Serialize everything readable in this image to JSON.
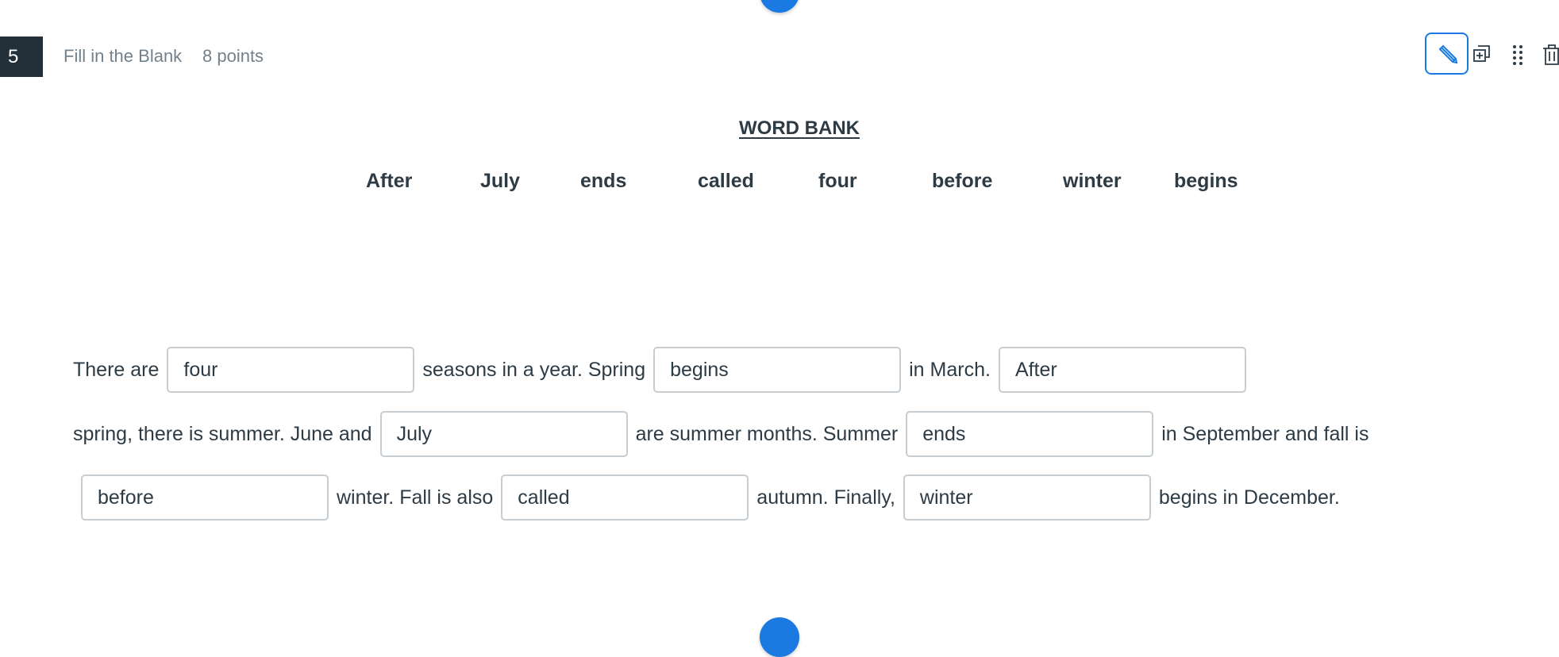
{
  "question": {
    "number": "5",
    "type": "Fill in the Blank",
    "points": "8 points"
  },
  "toolbar": {
    "edit": "pencil-icon",
    "duplicate": "duplicate-icon",
    "drag": "drag-handle-icon",
    "delete": "trash-icon"
  },
  "word_bank": {
    "title": "WORD BANK",
    "words": [
      "After",
      "July",
      "ends",
      "called",
      "four",
      "before",
      "winter",
      "begins"
    ]
  },
  "passage": {
    "line1": {
      "t1": "There are",
      "b1": "four",
      "t2": "seasons in a year. Spring",
      "b2": "begins",
      "t3": "in March.",
      "b3": "After"
    },
    "line2": {
      "t1": "spring, there is summer. June and",
      "b1": "July",
      "t2": "are summer months. Summer",
      "b2": "ends",
      "t3": "in September and fall is"
    },
    "line3": {
      "b1": "before",
      "t1": "winter. Fall is also",
      "b2": "called",
      "t2": "autumn. Finally,",
      "b3": "winter",
      "t3": "begins in December."
    }
  },
  "colors": {
    "accent": "#1a7ae2",
    "number_badge": "#243039",
    "text": "#2d3b45",
    "muted": "#73818c",
    "blank_border": "#c7cdd1"
  }
}
